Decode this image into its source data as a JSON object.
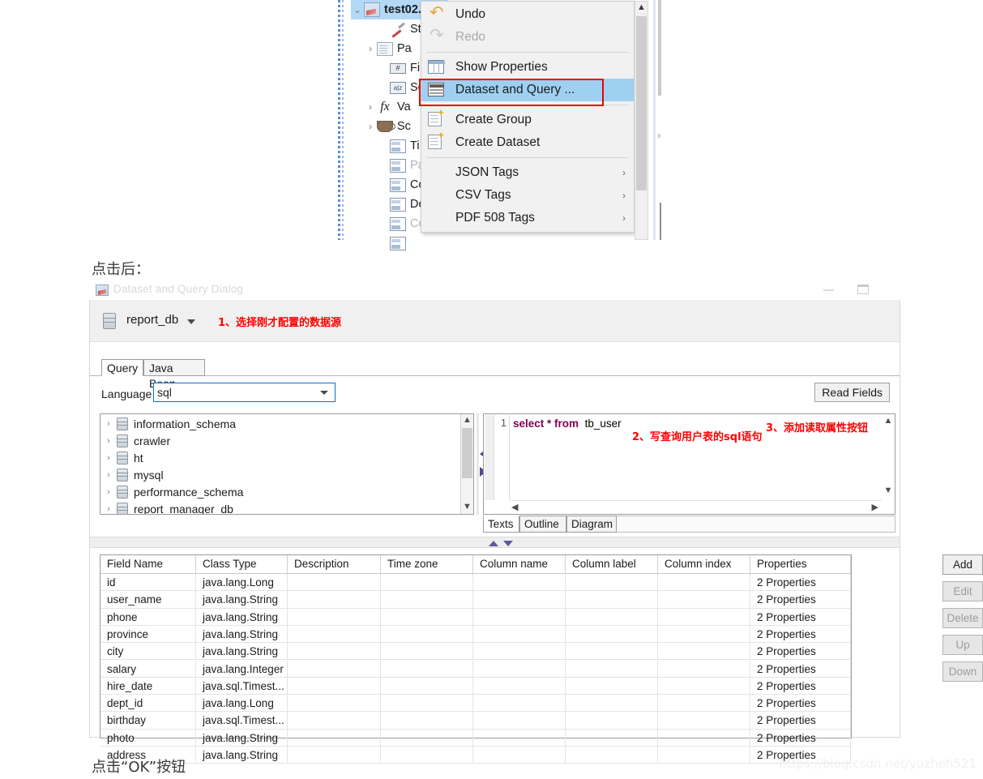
{
  "tree": {
    "root": {
      "label": "test02.",
      "icon": "report-icon",
      "selected": true,
      "expanded": true
    },
    "items": [
      {
        "label": "St",
        "icon": "pen-icon",
        "twisty": ""
      },
      {
        "label": "Pa",
        "icon": "page-icon",
        "twisty": "›"
      },
      {
        "label": "Fi",
        "icon": "hash-icon",
        "twisty": ""
      },
      {
        "label": "Sc",
        "icon": "az-icon",
        "twisty": ""
      },
      {
        "label": "Va",
        "icon": "fx-icon",
        "twisty": "›"
      },
      {
        "label": "Sc",
        "icon": "coffee-icon",
        "twisty": "›"
      },
      {
        "label": "Ti",
        "icon": "band-icon",
        "twisty": ""
      },
      {
        "label": "Pa",
        "icon": "band-icon",
        "twisty": "",
        "greyed": true
      },
      {
        "label": "Co",
        "icon": "band-icon",
        "twisty": ""
      },
      {
        "label": "De",
        "icon": "band-icon",
        "twisty": ""
      },
      {
        "label": "Co",
        "icon": "band-icon",
        "twisty": "",
        "greyed": true
      }
    ]
  },
  "context_menu": {
    "items": [
      {
        "label": "Undo",
        "icon": "undo-icon",
        "state": "enabled",
        "submenu": false
      },
      {
        "label": "Redo",
        "icon": "redo-icon",
        "state": "disabled",
        "submenu": false
      },
      {
        "label": "Show Properties",
        "icon": "grid-icon",
        "state": "enabled",
        "submenu": false
      },
      {
        "label": "Dataset and Query ...",
        "icon": "dataset-icon",
        "state": "highlighted",
        "submenu": false
      },
      {
        "label": "Create Group",
        "icon": "new-icon",
        "state": "enabled",
        "submenu": false
      },
      {
        "label": "Create Dataset",
        "icon": "new-icon",
        "state": "enabled",
        "submenu": false
      },
      {
        "label": "JSON Tags",
        "icon": "",
        "state": "enabled",
        "submenu": true
      },
      {
        "label": "CSV Tags",
        "icon": "",
        "state": "enabled",
        "submenu": true
      },
      {
        "label": "PDF 508 Tags",
        "icon": "",
        "state": "enabled",
        "submenu": true
      }
    ],
    "submenu_arrow": "›",
    "highlight_color": "#9fd0f2",
    "annotation_box_color": "#ee0000"
  },
  "captions": {
    "after_click": "点击后：",
    "click_ok": "点击“OK”按钮"
  },
  "dialog": {
    "title": "Dataset and Query Dialog",
    "datasource": {
      "name": "report_db",
      "icon": "database-icon"
    },
    "annotations": {
      "step1": "1、选择刚才配置的数据源",
      "step2": "2、写查询用户表的sql语句",
      "step3": "3、添加读取属性按钮"
    },
    "tabs": [
      {
        "label": "Query",
        "active": true
      },
      {
        "label": "Java Bean",
        "active": false
      }
    ],
    "language": {
      "label": "Language",
      "value": "sql"
    },
    "read_fields_button": "Read Fields",
    "schema_tree": [
      "information_schema",
      "crawler",
      "ht",
      "mysql",
      "performance_schema",
      "report_manager_db"
    ],
    "sql_editor": {
      "line_number": "1",
      "keywords": "select * from",
      "table": "tb_user",
      "full_text": "select * from  tb_user"
    },
    "editor_tabs": [
      {
        "label": "Texts",
        "active": true
      },
      {
        "label": "Outline",
        "active": false
      },
      {
        "label": "Diagram",
        "active": false
      }
    ],
    "fields_table": {
      "columns": [
        "Field Name",
        "Class Type",
        "Description",
        "Time zone",
        "Column name",
        "Column label",
        "Column index",
        "Properties"
      ],
      "rows": [
        [
          "id",
          "java.lang.Long",
          "",
          "",
          "",
          "",
          "",
          "2 Properties"
        ],
        [
          "user_name",
          "java.lang.String",
          "",
          "",
          "",
          "",
          "",
          "2 Properties"
        ],
        [
          "phone",
          "java.lang.String",
          "",
          "",
          "",
          "",
          "",
          "2 Properties"
        ],
        [
          "province",
          "java.lang.String",
          "",
          "",
          "",
          "",
          "",
          "2 Properties"
        ],
        [
          "city",
          "java.lang.String",
          "",
          "",
          "",
          "",
          "",
          "2 Properties"
        ],
        [
          "salary",
          "java.lang.Integer",
          "",
          "",
          "",
          "",
          "",
          "2 Properties"
        ],
        [
          "hire_date",
          "java.sql.Timest...",
          "",
          "",
          "",
          "",
          "",
          "2 Properties"
        ],
        [
          "dept_id",
          "java.lang.Long",
          "",
          "",
          "",
          "",
          "",
          "2 Properties"
        ],
        [
          "birthday",
          "java.sql.Timest...",
          "",
          "",
          "",
          "",
          "",
          "2 Properties"
        ],
        [
          "photo",
          "java.lang.String",
          "",
          "",
          "",
          "",
          "",
          "2 Properties"
        ],
        [
          "address",
          "java.lang.String",
          "",
          "",
          "",
          "",
          "",
          "2 Properties"
        ]
      ]
    },
    "side_buttons": [
      {
        "label": "Add",
        "enabled": true
      },
      {
        "label": "Edit",
        "enabled": false
      },
      {
        "label": "Delete",
        "enabled": false
      },
      {
        "label": "Up",
        "enabled": false
      },
      {
        "label": "Down",
        "enabled": false
      }
    ]
  },
  "watermark": "https://blog.csdn.net/yuzheh521"
}
